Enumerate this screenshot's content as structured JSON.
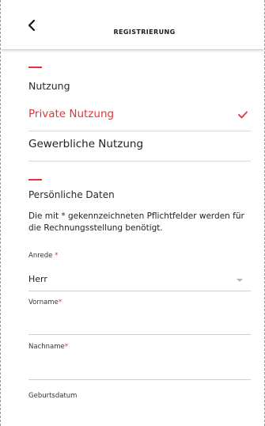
{
  "header": {
    "title": "REGISTRIERUNG",
    "back_icon": "chevron-left-icon"
  },
  "usage": {
    "heading": "Nutzung",
    "options": [
      {
        "label": "Private Nutzung",
        "selected": true
      },
      {
        "label": "Gewerbliche Nutzung",
        "selected": false
      }
    ]
  },
  "personal": {
    "heading": "Persönliche Daten",
    "info": "Die mit * gekennzeichneten Pflichtfelder werden für die Rechnungsstellung benötigt.",
    "salutation": {
      "label": "Anrede",
      "required_mark": "*",
      "value": "Herr"
    },
    "first_name": {
      "label": "Vorname",
      "required_mark": "*",
      "value": ""
    },
    "last_name": {
      "label": "Nachname",
      "required_mark": "*",
      "value": ""
    },
    "birth_date": {
      "label": "Geburtsdatum",
      "value": ""
    }
  },
  "colors": {
    "accent": "#e5323c",
    "divider": "#d8d8d8"
  }
}
